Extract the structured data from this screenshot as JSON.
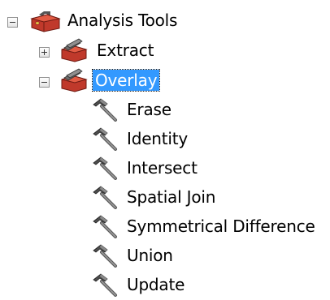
{
  "tree": {
    "root": {
      "label": "Analysis Tools",
      "expanded": true,
      "icon": "toolbox-icon"
    },
    "toolsets": [
      {
        "label": "Extract",
        "expanded": false,
        "selected": false,
        "icon": "toolset-icon"
      },
      {
        "label": "Overlay",
        "expanded": true,
        "selected": true,
        "icon": "toolset-icon",
        "tools": [
          {
            "label": "Erase",
            "icon": "hammer-icon"
          },
          {
            "label": "Identity",
            "icon": "hammer-icon"
          },
          {
            "label": "Intersect",
            "icon": "hammer-icon"
          },
          {
            "label": "Spatial Join",
            "icon": "hammer-icon"
          },
          {
            "label": "Symmetrical Difference",
            "icon": "hammer-icon"
          },
          {
            "label": "Union",
            "icon": "hammer-icon"
          },
          {
            "label": "Update",
            "icon": "hammer-icon"
          }
        ]
      }
    ]
  },
  "colors": {
    "selection": "#3399ff",
    "toolbox_red": "#c0392b"
  }
}
